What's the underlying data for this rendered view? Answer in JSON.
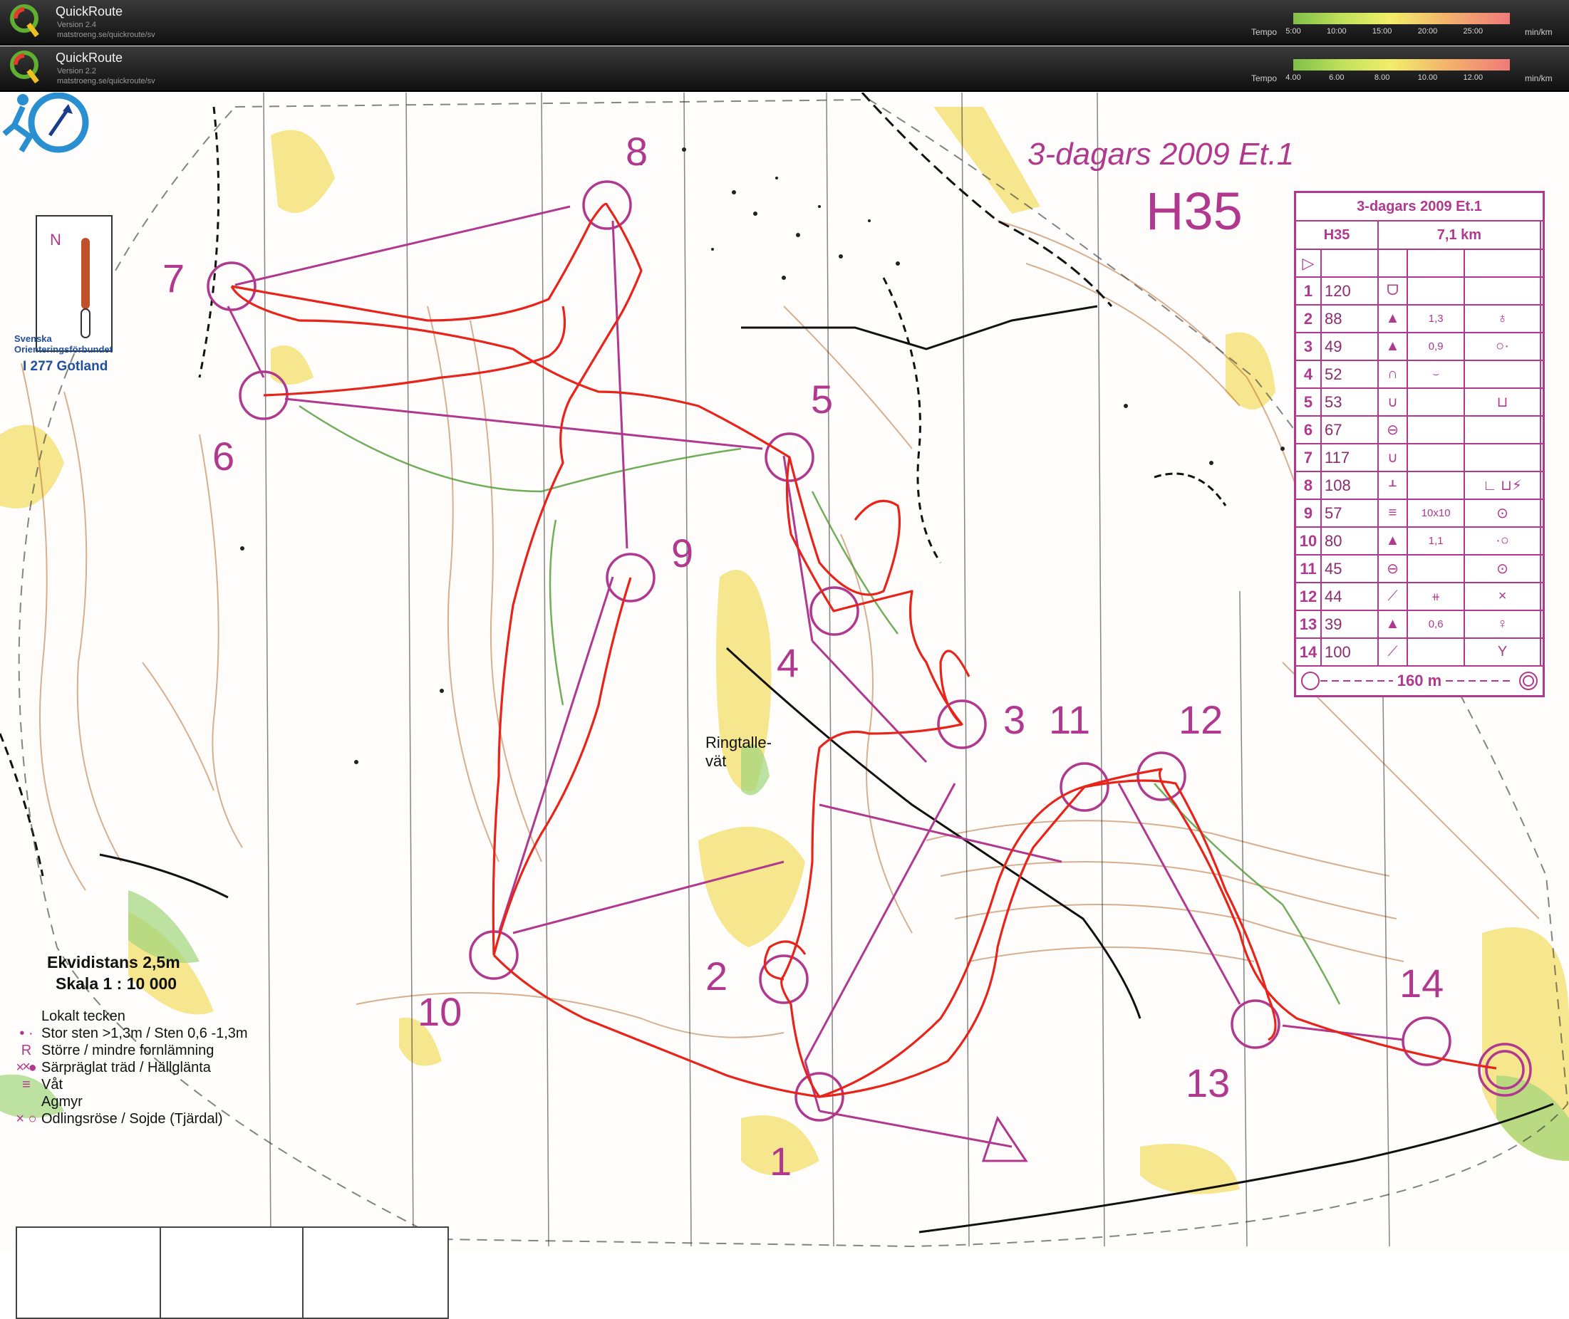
{
  "header_bars": [
    {
      "app_name": "QuickRoute",
      "version": "Version 2.4",
      "url": "matstroeng.se/quickroute/sv",
      "tempo_label": "Tempo",
      "unit_label": "min/km",
      "ticks": [
        "5:00",
        "10:00",
        "15:00",
        "20:00",
        "25:00"
      ]
    },
    {
      "app_name": "QuickRoute",
      "version": "Version 2.2",
      "url": "matstroeng.se/quickroute/sv",
      "tempo_label": "Tempo",
      "unit_label": "min/km",
      "ticks": [
        "4.00",
        "6.00",
        "8.00",
        "10.00",
        "12.00"
      ]
    }
  ],
  "map": {
    "title": "3-dagars 2009 Et.1",
    "class": "H35",
    "place_name": "Ringtalle-\nvät",
    "controls": [
      "1",
      "2",
      "3",
      "4",
      "5",
      "6",
      "7",
      "8",
      "9",
      "10",
      "11",
      "12",
      "13",
      "14"
    ],
    "colors": {
      "course": "#b0388f",
      "route": "#e8241a",
      "vegetation": "#f3e06a",
      "contour": "#b5703a"
    }
  },
  "control_descriptions": {
    "title": "3-dagars 2009 Et.1",
    "class": "H35",
    "length": "7,1 km",
    "start_symbol": "▷",
    "rows": [
      {
        "num": "1",
        "code": "120",
        "feature": "ᗜ",
        "dim": "",
        "loc": ""
      },
      {
        "num": "2",
        "code": "88",
        "feature": "▲",
        "dim": "1,3",
        "loc": "♁"
      },
      {
        "num": "3",
        "code": "49",
        "feature": "▲",
        "dim": "0,9",
        "loc": "○·"
      },
      {
        "num": "4",
        "code": "52",
        "feature": "∩",
        "dim": "⌣",
        "loc": ""
      },
      {
        "num": "5",
        "code": "53",
        "feature": "∪",
        "dim": "",
        "loc": "⊔"
      },
      {
        "num": "6",
        "code": "67",
        "feature": "⊖",
        "dim": "",
        "loc": ""
      },
      {
        "num": "7",
        "code": "117",
        "feature": "∪",
        "dim": "",
        "loc": ""
      },
      {
        "num": "8",
        "code": "108",
        "feature": "ᚆ",
        "dim": "",
        "loc": "∟ ⊔⚡"
      },
      {
        "num": "9",
        "code": "57",
        "feature": "≡",
        "dim": "10x10",
        "loc": "⊙"
      },
      {
        "num": "10",
        "code": "80",
        "feature": "▲",
        "dim": "1,1",
        "loc": "·○"
      },
      {
        "num": "11",
        "code": "45",
        "feature": "⊖",
        "dim": "",
        "loc": "⊙"
      },
      {
        "num": "12",
        "code": "44",
        "feature": "⟋",
        "dim": "⧺",
        "loc": "×"
      },
      {
        "num": "13",
        "code": "39",
        "feature": "▲",
        "dim": "0,6",
        "loc": "♀"
      },
      {
        "num": "14",
        "code": "100",
        "feature": "⟋",
        "dim": "",
        "loc": "Y"
      }
    ],
    "finish": "160 m"
  },
  "legend": {
    "ekvidistans": "Ekvidistans 2,5m",
    "skala": "Skala 1 : 10 000",
    "items": [
      {
        "marker": "",
        "text": "Lokalt tecken"
      },
      {
        "marker": "• ·",
        "text": "Stor sten >1,3m / Sten 0,6 -1,3m"
      },
      {
        "marker": "R ×",
        "text": "Större / mindre fornlämning"
      },
      {
        "marker": "× ●",
        "text": "Särpräglat träd / Hällglänta"
      },
      {
        "marker": "≡",
        "text": "Våt"
      },
      {
        "marker": "",
        "text": "Agmyr"
      },
      {
        "marker": "× ○",
        "text": "Odlingsröse / Sojde (Tjärdal)"
      }
    ]
  },
  "logo": {
    "org": "Svenska\nOrienteringsförbundet",
    "permit": "I 277 Gotland"
  }
}
